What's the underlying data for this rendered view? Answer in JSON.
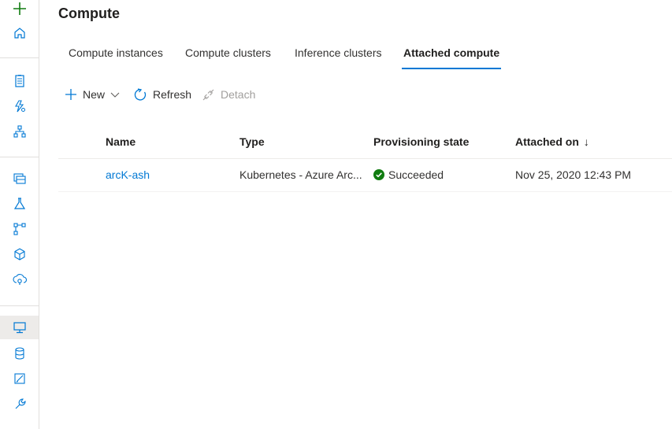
{
  "page": {
    "title": "Compute"
  },
  "rail": {
    "items": [
      {
        "icon": "plus-icon"
      },
      {
        "icon": "home-icon"
      },
      {
        "icon": "notebook-icon"
      },
      {
        "icon": "automated-ml-icon"
      },
      {
        "icon": "designer-icon"
      },
      {
        "icon": "datasets-icon"
      },
      {
        "icon": "experiments-icon"
      },
      {
        "icon": "pipelines-icon"
      },
      {
        "icon": "models-icon"
      },
      {
        "icon": "endpoints-icon"
      },
      {
        "icon": "compute-icon",
        "active": true
      },
      {
        "icon": "datastores-icon"
      },
      {
        "icon": "data-labeling-icon"
      },
      {
        "icon": "linked-services-icon"
      }
    ]
  },
  "tabs": [
    {
      "label": "Compute instances"
    },
    {
      "label": "Compute clusters"
    },
    {
      "label": "Inference clusters"
    },
    {
      "label": "Attached compute",
      "active": true
    }
  ],
  "toolbar": {
    "new_label": "New",
    "refresh_label": "Refresh",
    "detach_label": "Detach"
  },
  "table": {
    "columns": {
      "name": "Name",
      "type": "Type",
      "state": "Provisioning state",
      "attached": "Attached on"
    },
    "sort_indicator": "↓",
    "rows": [
      {
        "name": "arcK-ash",
        "type": "Kubernetes - Azure Arc...",
        "state": "Succeeded",
        "attached": "Nov 25, 2020 12:43 PM"
      }
    ]
  },
  "colors": {
    "accent": "#0078d4",
    "add_green": "#107c10",
    "success": "#107c10"
  }
}
